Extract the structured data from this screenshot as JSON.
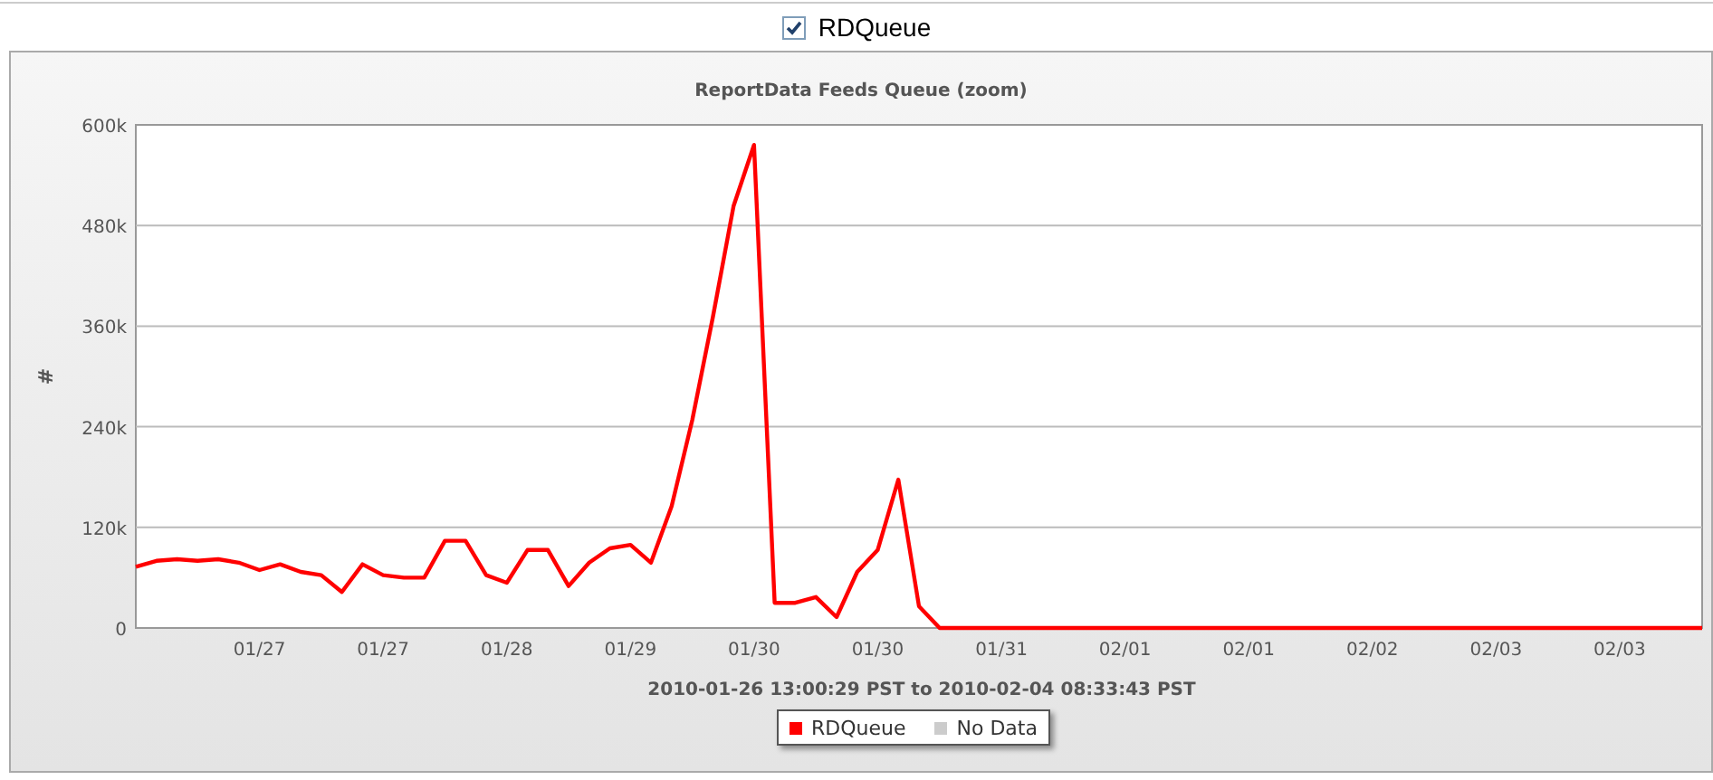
{
  "series_toggle": {
    "label": "RDQueue",
    "checked": true
  },
  "chart": {
    "chart_data": {
      "type": "line",
      "title": "ReportData Feeds Queue (zoom)",
      "xlabel": "2010-01-26 13:00:29 PST to 2010-02-04 08:33:43 PST",
      "ylabel": "#",
      "categories": [
        null,
        null,
        null,
        null,
        null,
        null,
        "01/27",
        null,
        null,
        null,
        null,
        null,
        "01/27",
        null,
        null,
        null,
        null,
        null,
        "01/28",
        null,
        null,
        null,
        null,
        null,
        "01/29",
        null,
        null,
        null,
        null,
        null,
        "01/30",
        null,
        null,
        null,
        null,
        null,
        "01/30",
        null,
        null,
        null,
        null,
        null,
        "01/31",
        null,
        null,
        null,
        null,
        null,
        "02/01",
        null,
        null,
        null,
        null,
        null,
        "02/01",
        null,
        null,
        null,
        null,
        null,
        "02/02",
        null,
        null,
        null,
        null,
        null,
        "02/03",
        null,
        null,
        null,
        null,
        null,
        "02/03",
        null,
        null,
        null,
        null
      ],
      "series": [
        {
          "name": "RDQueue",
          "color": "#ff0000",
          "values": [
            73000,
            80000,
            82000,
            80000,
            82000,
            78000,
            69000,
            76000,
            67000,
            63000,
            43000,
            76000,
            63000,
            60000,
            60000,
            104000,
            104000,
            63000,
            54000,
            93000,
            93000,
            50000,
            78000,
            95000,
            99000,
            78000,
            145000,
            248000,
            371000,
            503000,
            576000,
            30000,
            30000,
            37000,
            13000,
            67000,
            93000,
            177000,
            26000,
            0,
            0,
            0,
            0,
            0,
            0,
            0,
            0,
            0,
            0,
            0,
            0,
            0,
            0,
            0,
            0,
            0,
            0,
            0,
            0,
            0,
            0,
            0,
            0,
            0,
            0,
            0,
            0,
            0,
            0,
            0,
            0,
            0,
            0,
            0,
            0,
            0,
            0
          ]
        }
      ],
      "ylim": [
        0,
        600000
      ],
      "grid": "y",
      "yticks": [
        {
          "value": 0,
          "label": "0"
        },
        {
          "value": 120000,
          "label": "120k"
        },
        {
          "value": 240000,
          "label": "240k"
        },
        {
          "value": 360000,
          "label": "360k"
        },
        {
          "value": 480000,
          "label": "480k"
        },
        {
          "value": 600000,
          "label": "600k"
        }
      ]
    },
    "legend_extra": [
      {
        "label": "No Data",
        "color": "#cccccc"
      }
    ]
  }
}
